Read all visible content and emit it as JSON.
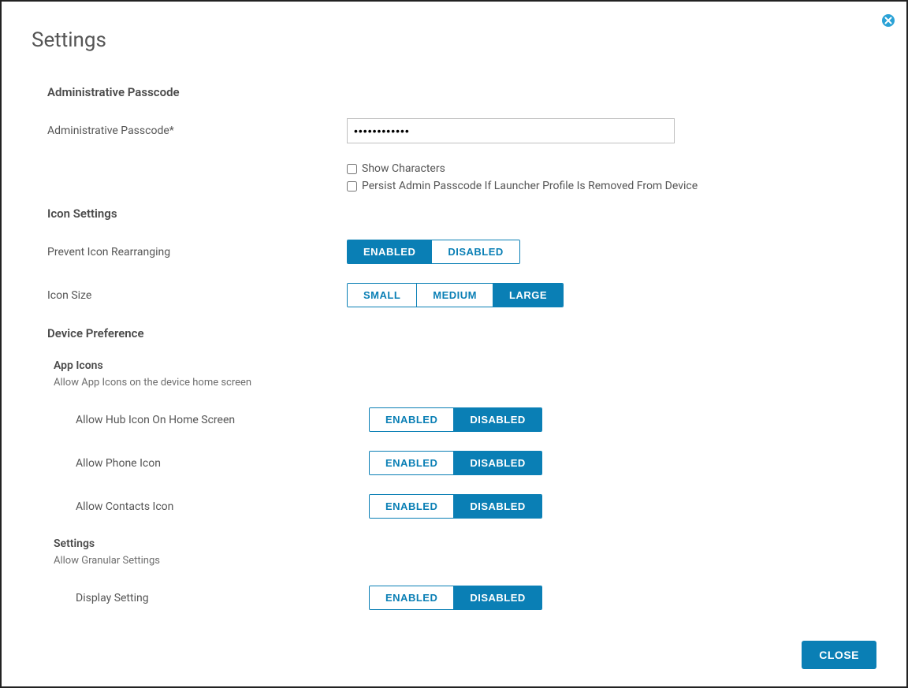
{
  "title": "Settings",
  "sections": {
    "admin": {
      "heading": "Administrative Passcode",
      "field_label": "Administrative Passcode*",
      "passcode_value": "••••••••••••",
      "show_chars_label": "Show Characters",
      "persist_label": "Persist Admin Passcode If Launcher Profile Is Removed From Device"
    },
    "icon_settings": {
      "heading": "Icon Settings",
      "prevent_label": "Prevent Icon Rearranging",
      "prevent_options": [
        "ENABLED",
        "DISABLED"
      ],
      "prevent_active": "ENABLED",
      "size_label": "Icon Size",
      "size_options": [
        "SMALL",
        "MEDIUM",
        "LARGE"
      ],
      "size_active": "LARGE"
    },
    "device_pref": {
      "heading": "Device Preference",
      "app_icons": {
        "heading": "App Icons",
        "desc": "Allow App Icons on the device home screen",
        "rows": [
          {
            "label": "Allow Hub Icon On Home Screen",
            "active": "DISABLED"
          },
          {
            "label": "Allow Phone Icon",
            "active": "DISABLED"
          },
          {
            "label": "Allow Contacts Icon",
            "active": "DISABLED"
          }
        ]
      },
      "settings_group": {
        "heading": "Settings",
        "desc": "Allow Granular Settings",
        "rows": [
          {
            "label": "Display Setting",
            "active": "DISABLED"
          }
        ]
      }
    }
  },
  "toggle_labels": {
    "enabled": "ENABLED",
    "disabled": "DISABLED"
  },
  "close_label": "CLOSE"
}
